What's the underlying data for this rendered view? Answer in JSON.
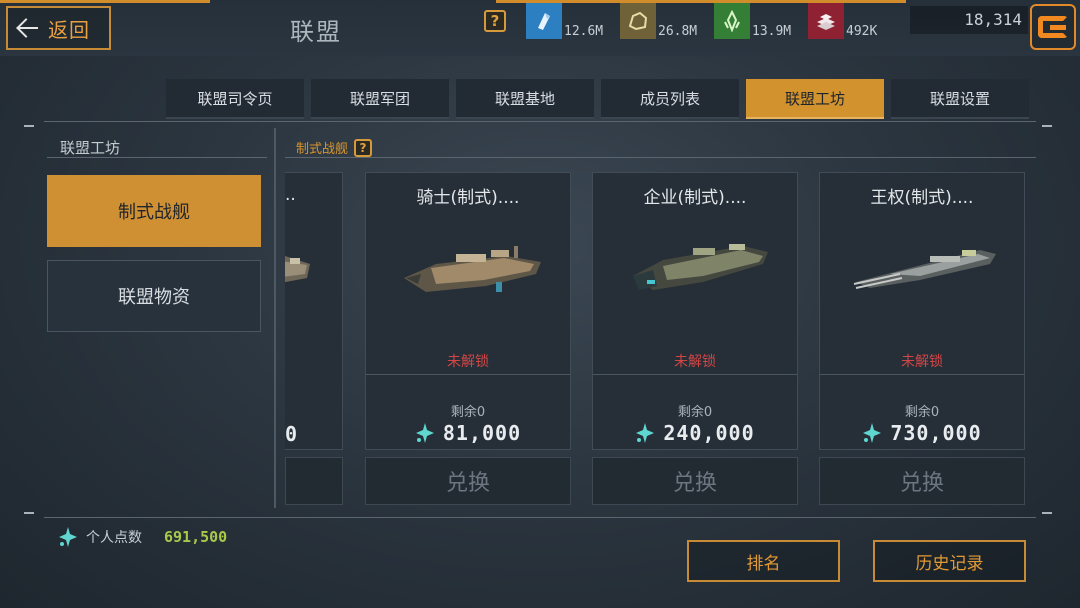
{
  "header": {
    "back_label": "返回",
    "title": "联盟",
    "resources": [
      {
        "icon": "crystal-shard-icon",
        "value": "12.6M",
        "color": "#2c7fc0"
      },
      {
        "icon": "ore-rock-icon",
        "value": "26.8M",
        "color": "#7a6a3a"
      },
      {
        "icon": "green-crystal-icon",
        "value": "13.9M",
        "color": "#3b8a3a"
      },
      {
        "icon": "metal-ingot-icon",
        "value": "492K",
        "color": "#9a2a3a"
      }
    ],
    "credits": "18,314"
  },
  "tabs": [
    {
      "label": "联盟司令页",
      "active": false
    },
    {
      "label": "联盟军团",
      "active": false
    },
    {
      "label": "联盟基地",
      "active": false
    },
    {
      "label": "成员列表",
      "active": false
    },
    {
      "label": "联盟工坊",
      "active": true
    },
    {
      "label": "联盟设置",
      "active": false
    }
  ],
  "sidebar": {
    "title": "联盟工坊",
    "items": [
      {
        "label": "制式战舰",
        "active": true
      },
      {
        "label": "联盟物资",
        "active": false
      }
    ]
  },
  "section": {
    "title": "制式战舰"
  },
  "partial_card": {
    "name_tail": "..",
    "price_tail": "0"
  },
  "cards": [
    {
      "name": "骑士(制式)....",
      "status": "未解锁",
      "remaining": "剩余0",
      "price": "81,000",
      "button": "兑换"
    },
    {
      "name": "企业(制式)....",
      "status": "未解锁",
      "remaining": "剩余0",
      "price": "240,000",
      "button": "兑换"
    },
    {
      "name": "王权(制式)....",
      "status": "未解锁",
      "remaining": "剩余0",
      "price": "730,000",
      "button": "兑换"
    }
  ],
  "footer": {
    "points_label": "个人点数",
    "points_value": "691,500",
    "rank_button": "排名",
    "history_button": "历史记录"
  },
  "colors": {
    "accent": "#d2932f",
    "locked": "#d24545",
    "points": "#a9c94a"
  }
}
